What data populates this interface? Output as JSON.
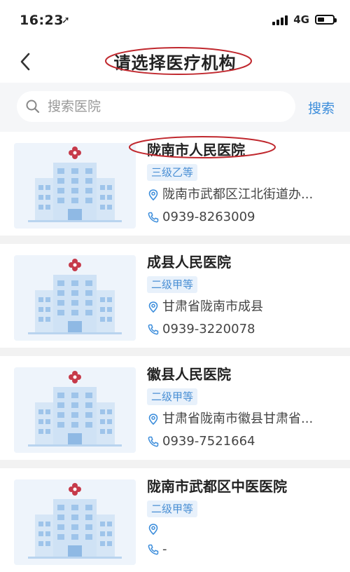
{
  "status_bar": {
    "time": "16:23",
    "network": "4G"
  },
  "nav": {
    "title": "请选择医疗机构"
  },
  "search": {
    "placeholder": "搜索医院",
    "button": "搜索"
  },
  "hospitals": [
    {
      "name": "陇南市人民医院",
      "level": "三级乙等",
      "address": "陇南市武都区江北街道办...",
      "phone": "0939-8263009"
    },
    {
      "name": "成县人民医院",
      "level": "二级甲等",
      "address": "甘肃省陇南市成县",
      "phone": "0939-3220078"
    },
    {
      "name": "徽县人民医院",
      "level": "二级甲等",
      "address": "甘肃省陇南市徽县甘肃省...",
      "phone": "0939-7521664"
    },
    {
      "name": "陇南市武都区中医医院",
      "level": "二级甲等",
      "address": "",
      "phone": "-"
    }
  ],
  "colors": {
    "accent": "#3c8ddb",
    "annotation": "#c0282e",
    "cross": "#c63a4a"
  }
}
